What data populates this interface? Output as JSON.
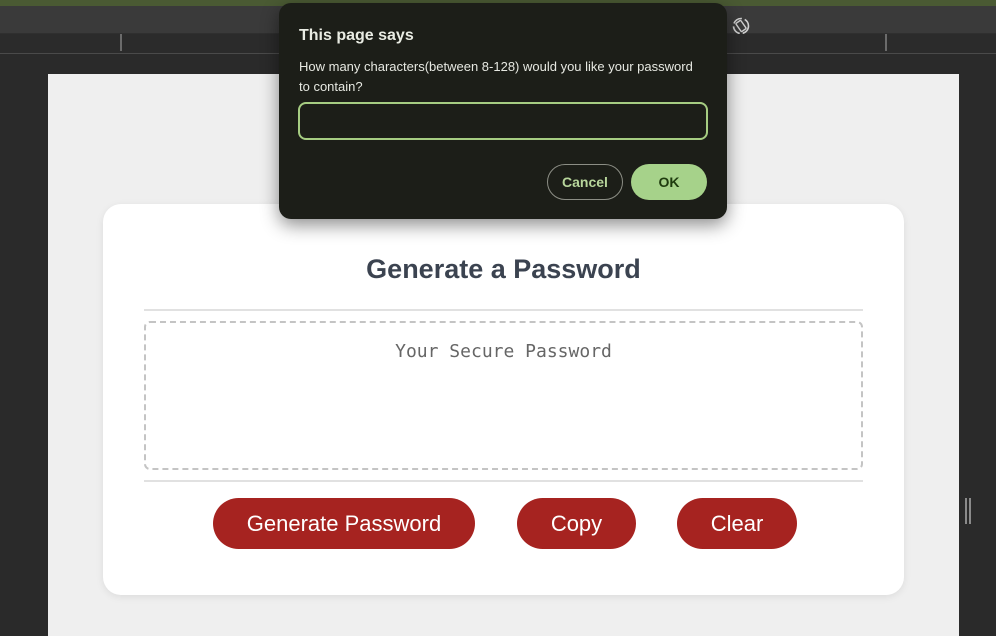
{
  "dialog": {
    "title": "This page says",
    "message": "How many characters(between 8-128) would you like your password to contain?",
    "input_value": "",
    "cancel_label": "Cancel",
    "ok_label": "OK"
  },
  "card": {
    "title": "Generate a Password",
    "password_placeholder": "Your Secure Password",
    "buttons": {
      "generate": "Generate Password",
      "copy": "Copy",
      "clear": "Clear"
    }
  },
  "colors": {
    "accent_button": "#a62320",
    "dialog_accent": "#a6d28a",
    "dialog_background": "#1c1e18",
    "title_text": "#3b4350"
  },
  "icons": {
    "toolbar_rotate": "rotate-device-icon",
    "side_handle": "drag-handle-icon"
  }
}
